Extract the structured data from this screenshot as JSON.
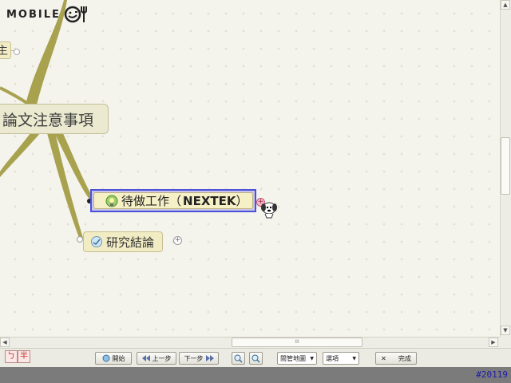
{
  "logo": {
    "text": "MOBILE",
    "icon": "smiley-fork-icon"
  },
  "mindmap": {
    "sub_node_label": "主",
    "main_topic": "論文注意事項",
    "selected_node": {
      "label": "待做工作（",
      "bold": "NEXTEK",
      "suffix": "）",
      "icon": "task-icon"
    },
    "child_node": {
      "label": "研究結論",
      "icon": "research-icon"
    },
    "expand_symbol": "+",
    "cursor_icon": "dog-cursor-icon",
    "branch_color": "#a8a24f"
  },
  "scrollbar": {
    "up": "▲",
    "down": "▼",
    "left": "◀",
    "right": "▶",
    "grip": "III"
  },
  "toolbar": {
    "ime": [
      "ㄅ",
      "半"
    ],
    "start": "開始",
    "prev": "上一步",
    "next": "下一步",
    "zoom_in": "+",
    "zoom_out": "−",
    "map_menu": "閱管地圖",
    "options_menu": "選項",
    "done": "完成",
    "dropdown_arrow": "▼",
    "close_x": "✕"
  },
  "status": {
    "id": "#20119"
  }
}
